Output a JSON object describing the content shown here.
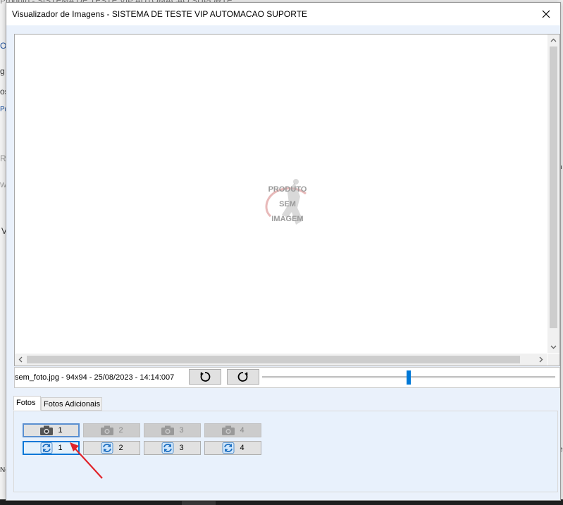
{
  "background": {
    "window_title": "Produto - SISTEMA DE TESTE VIP AUTOMACAO SUPORTE",
    "left_glyphs": [
      "O",
      "g",
      "os",
      "Pr",
      "R",
      "W",
      "V",
      "Nc"
    ],
    "right_glyphs": [
      "i/",
      "n",
      "e"
    ]
  },
  "dialog": {
    "title": "Visualizador de Imagens - SISTEMA DE TESTE VIP AUTOMACAO SUPORTE",
    "placeholder_image": {
      "line1": "PRODUTO",
      "line2": "SEM",
      "line3": "IMAGEM"
    },
    "file_info": "sem_foto.jpg -  94x94 - 25/08/2023 - 14:14:007",
    "zoom_level": 0.5,
    "tabs": [
      {
        "label": "Fotos",
        "active": true
      },
      {
        "label": "Fotos Adicionais",
        "active": false
      }
    ],
    "photo_slots": [
      {
        "label": "1",
        "icon": "camera-icon",
        "enabled": true
      },
      {
        "label": "2",
        "icon": "camera-icon",
        "enabled": false
      },
      {
        "label": "3",
        "icon": "camera-icon",
        "enabled": false
      },
      {
        "label": "4",
        "icon": "camera-icon",
        "enabled": false
      }
    ],
    "refresh_slots": [
      {
        "label": "1",
        "icon": "refresh-icon",
        "selected": true
      },
      {
        "label": "2",
        "icon": "refresh-icon",
        "selected": false
      },
      {
        "label": "3",
        "icon": "refresh-icon",
        "selected": false
      },
      {
        "label": "4",
        "icon": "refresh-icon",
        "selected": false
      }
    ]
  },
  "colors": {
    "accent": "#0078d7",
    "annotation_arrow": "#e0232a",
    "client_bg": "#eaf1fb"
  }
}
